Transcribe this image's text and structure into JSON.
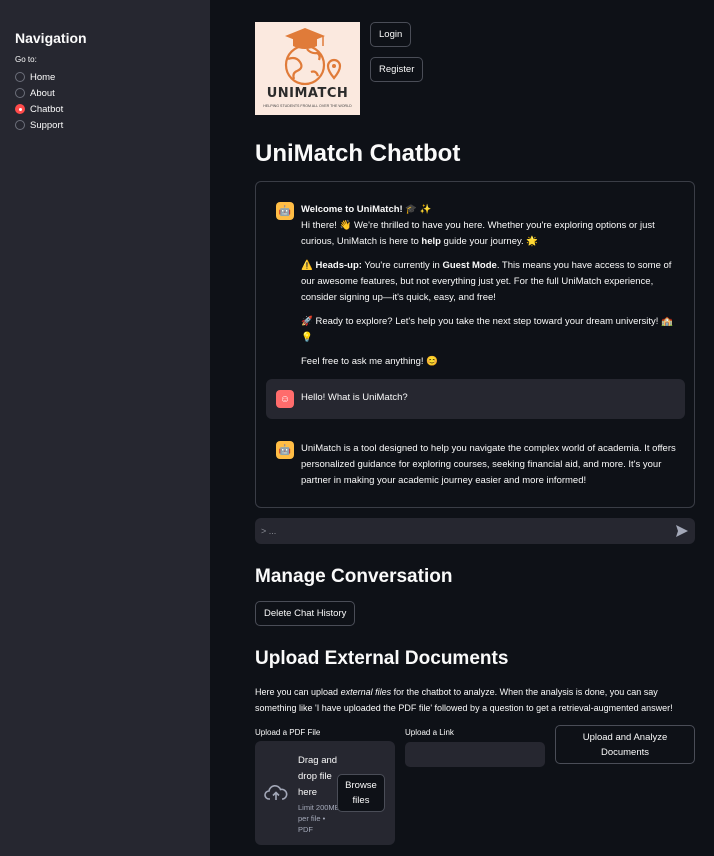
{
  "sidebar": {
    "title": "Navigation",
    "goto_label": "Go to:",
    "items": [
      {
        "label": "Home",
        "selected": false
      },
      {
        "label": "About",
        "selected": false
      },
      {
        "label": "Chatbot",
        "selected": true
      },
      {
        "label": "Support",
        "selected": false
      }
    ]
  },
  "header": {
    "logo": {
      "brand": "UNIMATCH",
      "tagline": "HELPING STUDENTS FROM ALL OVER THE WORLD"
    },
    "login_label": "Login",
    "register_label": "Register"
  },
  "page_title": "UniMatch Chatbot",
  "chat": {
    "messages": [
      {
        "role": "assistant",
        "title": "Welcome to UniMatch! 🎓 ✨",
        "line1_pre": "Hi there! 👋 We're thrilled to have you here. Whether you're exploring options or just curious, UniMatch is here to ",
        "line1_bold": "help",
        "line1_post": " guide your journey. 🌟",
        "heads_up_icon": "⚠️",
        "heads_up_label": "Heads-up:",
        "heads_up_pre": " You're currently in ",
        "heads_up_mode": "Guest Mode",
        "heads_up_post": ". This means you have access to some of our awesome features, but not everything just yet. For the full UniMatch experience, consider signing up—it's quick, easy, and free!",
        "explore": "🚀 Ready to explore? Let's help you take the next step toward your dream university! 🏫 💡",
        "closing": "Feel free to ask me anything! 😊"
      },
      {
        "role": "user",
        "text": "Hello! What is UniMatch?"
      },
      {
        "role": "assistant",
        "text": "UniMatch is a tool designed to help you navigate the complex world of academia. It offers personalized guidance for exploring courses, seeking financial aid, and more. It's your partner in making your academic journey easier and more informed!"
      }
    ],
    "input_placeholder": "> ...",
    "send_icon": "send-icon"
  },
  "manage": {
    "title": "Manage Conversation",
    "delete_label": "Delete Chat History"
  },
  "upload": {
    "title": "Upload External Documents",
    "desc_pre": "Here you can upload ",
    "desc_em": "external files",
    "desc_post": " for the chatbot to analyze. When the analysis is done, you can say something like 'I have uploaded the PDF file' followed by a question to get a retrieval-augmented answer!",
    "pdf_label": "Upload a PDF File",
    "drop_text": "Drag and drop file here",
    "limit_text": "Limit 200MB per file • PDF",
    "browse_label": "Browse files",
    "link_label": "Upload a Link",
    "link_value": "",
    "analyze_label": "Upload and Analyze Documents"
  },
  "colors": {
    "background": "#0e1117",
    "sidebar": "#262730",
    "accent": "#ff4b4b",
    "bot_avatar": "#ffbd45",
    "user_avatar": "#ff6c6c",
    "logo_orange": "#e07b39"
  }
}
